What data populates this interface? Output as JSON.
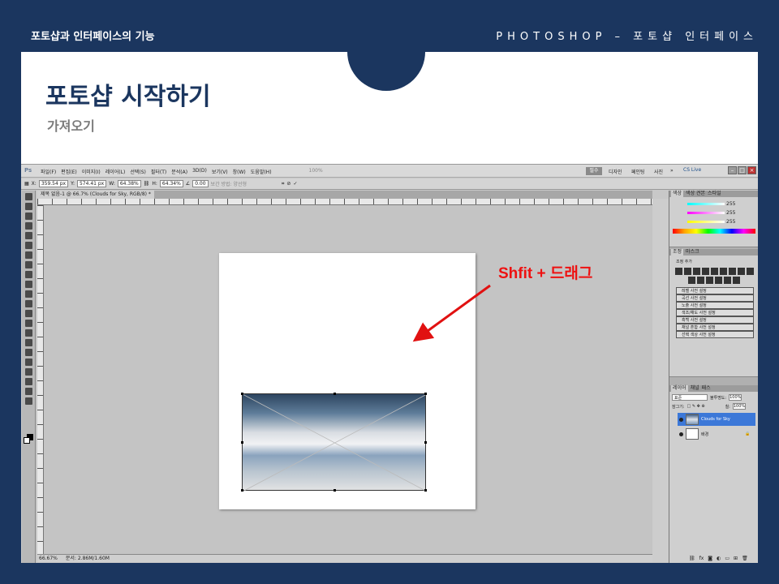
{
  "header": {
    "left": "포토샵과 인터페이스의 기능",
    "right": "PHOTOSHOP – 포토샵 인터페이스"
  },
  "slide": {
    "title": "포토샵 시작하기",
    "subtitle": "가져오기",
    "annotation": "Shfit + 드래그",
    "accent_color": "#e11111"
  },
  "photoshop": {
    "logo": "Ps",
    "menus": [
      "파일(F)",
      "편집(E)",
      "이미지(I)",
      "레이어(L)",
      "선택(S)",
      "필터(T)",
      "분석(A)",
      "3D(D)",
      "보기(V)",
      "창(W)",
      "도움말(H)"
    ],
    "zoom_menu": "100%",
    "workspaces": {
      "active": "필수",
      "design": "디자인",
      "paint": "페인팅",
      "photo": "사진",
      "more": "»"
    },
    "cs_live": "CS Live",
    "options": {
      "x": "359.54 px",
      "y": "574.41 px",
      "w": "64.38%",
      "h": "64.34%",
      "angle": "0.00",
      "interp": "보간 방법: 양선형"
    },
    "doc_tab": "제목 없음-1 @ 66.7% (Clouds for Sky, RGB/8) *",
    "status": {
      "zoom": "66.67%",
      "doc": "문서: 2.86M/1.60M"
    },
    "color_panel": {
      "tabs": [
        "색상",
        "색상 견본",
        "스타일"
      ],
      "values": [
        "255",
        "255",
        "255"
      ]
    },
    "adjust_panel": {
      "tabs": [
        "조정",
        "마스크"
      ],
      "title": "조정 추가",
      "presets": [
        "레벨 사전 설정",
        "곡선 사전 설정",
        "노출 사전 설정",
        "색조/채도 사전 설정",
        "흑백 사전 설정",
        "채널 혼합 사전 설정",
        "선택 색상 사전 설정"
      ]
    },
    "layers_panel": {
      "tabs": [
        "레이어",
        "채널",
        "패스"
      ],
      "blend": "표준",
      "opacity_label": "불투명도:",
      "opacity": "100%",
      "lock_label": "잠그기:",
      "fill_label": "칠:",
      "fill": "100%",
      "layers": [
        {
          "name": "Clouds for Sky",
          "selected": true
        },
        {
          "name": "배경",
          "selected": false
        }
      ]
    }
  }
}
